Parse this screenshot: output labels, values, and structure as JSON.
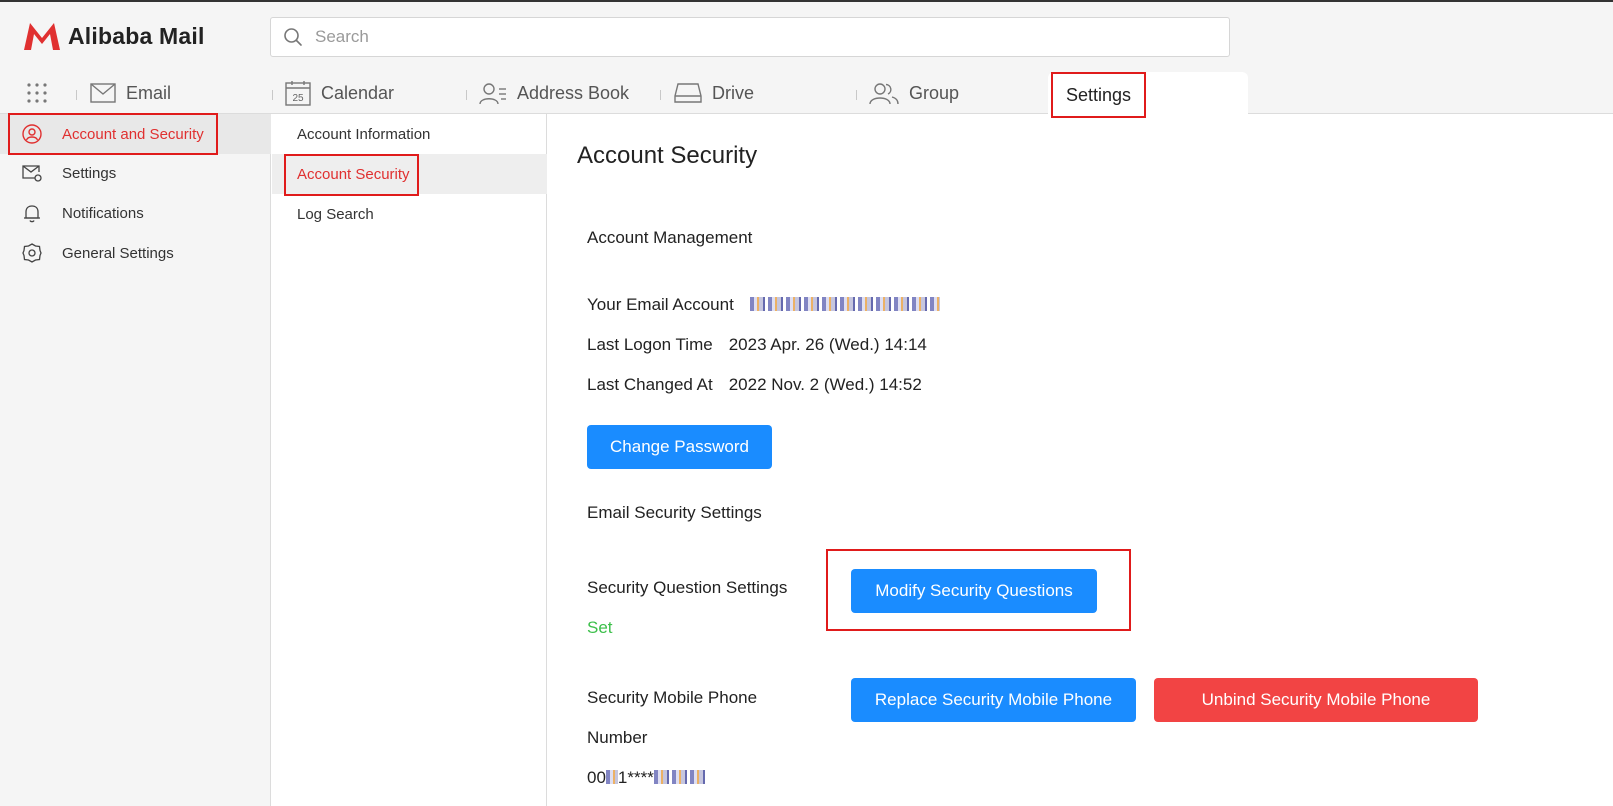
{
  "app": {
    "logo_text": "Alibaba Mail",
    "brand_color": "#e03030"
  },
  "search": {
    "placeholder": "Search"
  },
  "nav": {
    "items": [
      {
        "label": "Email",
        "icon": "envelope-icon"
      },
      {
        "label": "Calendar",
        "icon": "calendar-icon",
        "icon_text": "25"
      },
      {
        "label": "Address Book",
        "icon": "contacts-icon"
      },
      {
        "label": "Drive",
        "icon": "drive-icon"
      },
      {
        "label": "Group",
        "icon": "group-icon"
      }
    ],
    "active": {
      "label": "Settings"
    }
  },
  "sidebar": {
    "items": [
      {
        "label": "Account and Security",
        "icon": "user-circle-icon",
        "active": true
      },
      {
        "label": "Settings",
        "icon": "mail-settings-icon"
      },
      {
        "label": "Notifications",
        "icon": "bell-icon"
      },
      {
        "label": "General Settings",
        "icon": "gear-icon"
      }
    ]
  },
  "subnav": {
    "items": [
      {
        "label": "Account Information"
      },
      {
        "label": "Account Security",
        "active": true
      },
      {
        "label": "Log Search"
      }
    ]
  },
  "main": {
    "title": "Account Security",
    "account_management": {
      "heading": "Account Management",
      "email_label": "Your Email Account",
      "email_value": "postmaster@test.com (blurred)",
      "last_logon_label": "Last Logon Time",
      "last_logon_value": "2023 Apr. 26 (Wed.) 14:14",
      "last_changed_label": "Last Changed At",
      "last_changed_value": "2022 Nov. 2 (Wed.) 14:52",
      "change_password_label": "Change Password"
    },
    "email_security": {
      "heading": "Email Security Settings",
      "question_label": "Security Question Settings",
      "question_status": "Set",
      "modify_button": "Modify Security Questions",
      "phone_label_line1": "Security Mobile Phone",
      "phone_label_line2": "Number",
      "phone_value_prefix": "00",
      "phone_value_mid": "1****",
      "replace_button": "Replace Security Mobile Phone",
      "unbind_button": "Unbind Security Mobile Phone"
    }
  },
  "colors": {
    "primary_button": "#1a8cff",
    "danger_button": "#f24444",
    "success_text": "#3cbf4a",
    "highlight_box": "#e01b1b"
  }
}
